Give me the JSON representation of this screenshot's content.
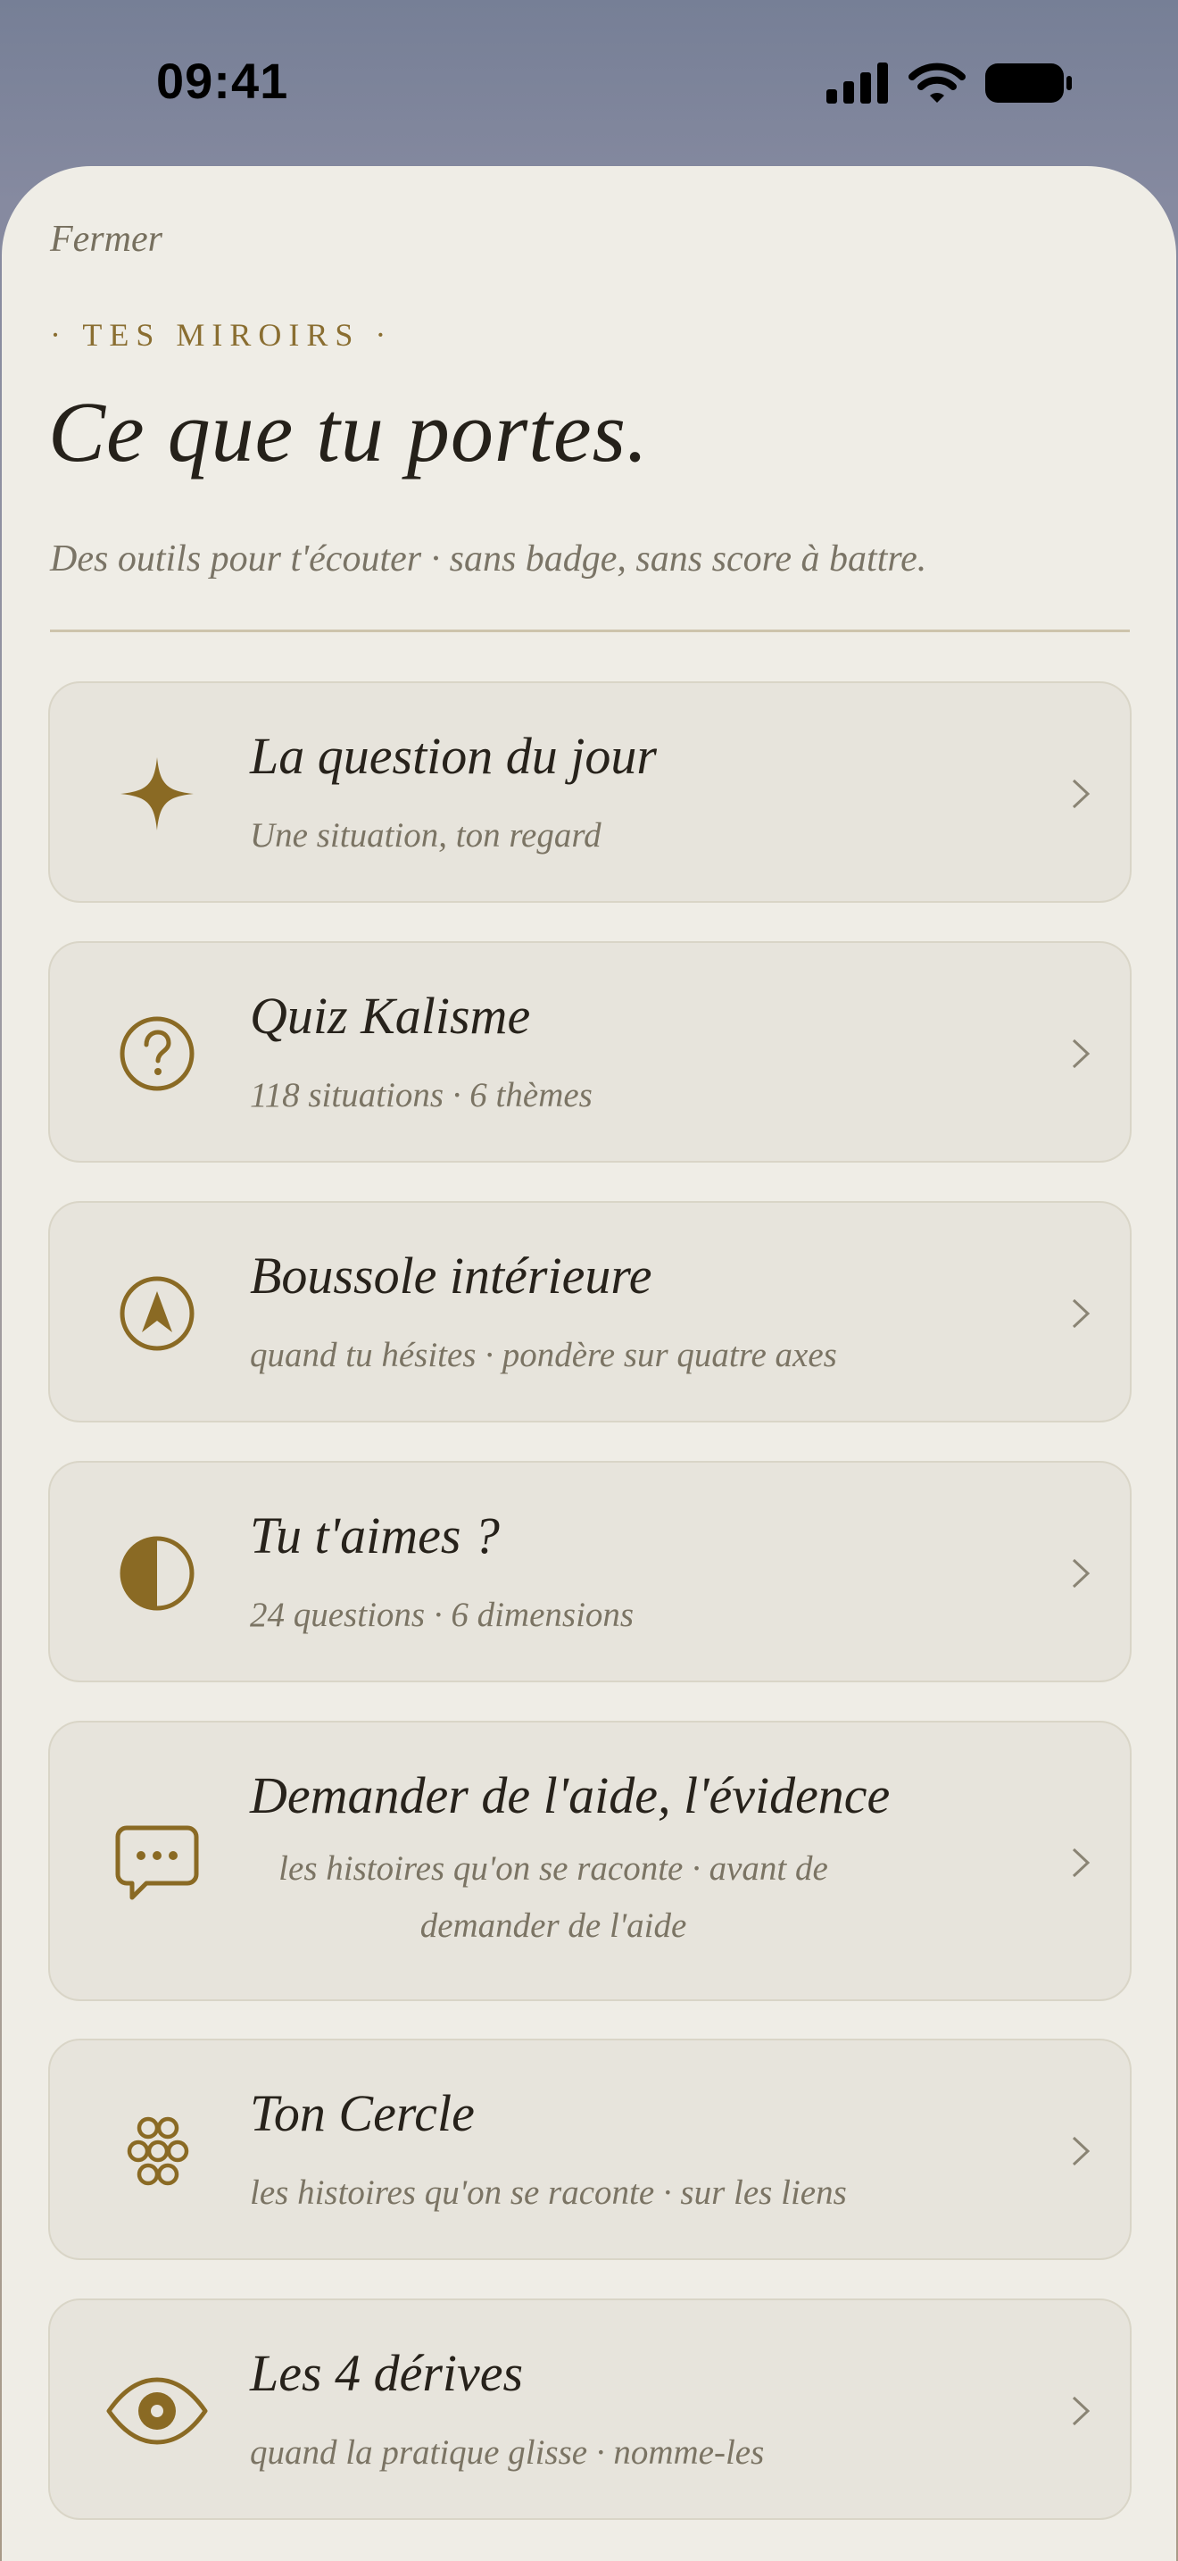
{
  "status_bar": {
    "time": "09:41",
    "icons": [
      "signal-icon",
      "wifi-icon",
      "battery-icon"
    ]
  },
  "sheet": {
    "close_label": "Fermer",
    "eyebrow": "· TES MIROIRS ·",
    "title": "Ce que tu portes.",
    "subtitle": "Des outils pour t'écouter · sans badge, sans score à battre."
  },
  "cards": [
    {
      "title": "La question du jour",
      "subtitle": "Une situation, ton regard",
      "icon": "sparkle-icon"
    },
    {
      "title": "Quiz Kalisme",
      "subtitle": "118 situations · 6 thèmes",
      "icon": "question-circle-icon"
    },
    {
      "title": "Boussole intérieure",
      "subtitle": "quand tu hésites · pondère sur quatre axes",
      "icon": "compass-icon"
    },
    {
      "title": "Tu t'aimes ?",
      "subtitle": "24 questions · 6 dimensions",
      "icon": "half-circle-icon"
    },
    {
      "title": "Demander de l'aide, l'évidence",
      "subtitle": "les histoires qu'on se raconte · avant de demander de l'aide",
      "icon": "chat-bubble-icon"
    },
    {
      "title": "Ton Cercle",
      "subtitle": "les histoires qu'on se raconte · sur les liens",
      "icon": "circle-cluster-icon"
    },
    {
      "title": "Les 4 dérives",
      "subtitle": "quand la pratique glisse · nomme-les",
      "icon": "eye-icon"
    }
  ],
  "colors": {
    "accent": "#8a6a24",
    "sheet_bg": "#efede6",
    "card_bg": "#e7e4dc",
    "title_text": "#27221b",
    "muted_text": "#7b7464"
  }
}
